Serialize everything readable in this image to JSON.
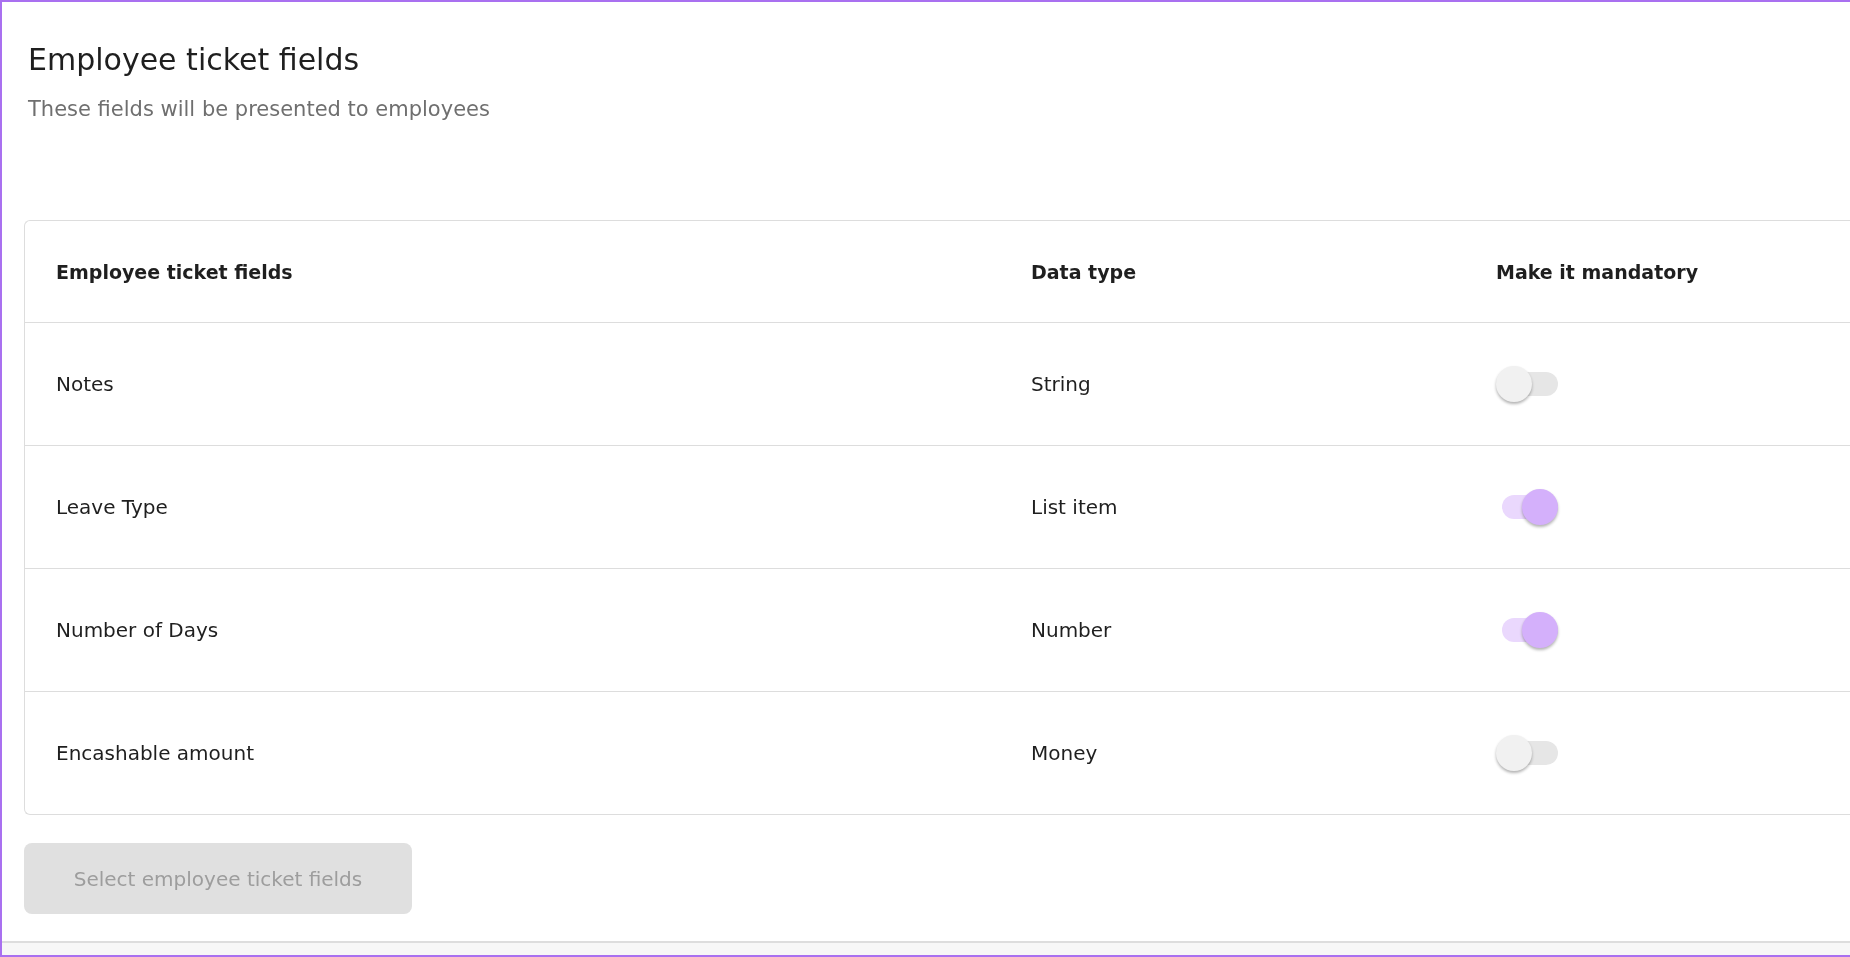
{
  "title": "Employee ticket fields",
  "subtitle": "These fields will be presented to employees",
  "table": {
    "columns": [
      "Employee ticket fields",
      "Data type",
      "Make it mandatory"
    ],
    "rows": [
      {
        "field": "Notes",
        "data_type": "String",
        "mandatory": false
      },
      {
        "field": "Leave Type",
        "data_type": "List item",
        "mandatory": true
      },
      {
        "field": "Number of Days",
        "data_type": "Number",
        "mandatory": true
      },
      {
        "field": "Encashable amount",
        "data_type": "Money",
        "mandatory": false
      }
    ]
  },
  "select_button": {
    "label": "Select employee ticket fields",
    "disabled": true
  }
}
